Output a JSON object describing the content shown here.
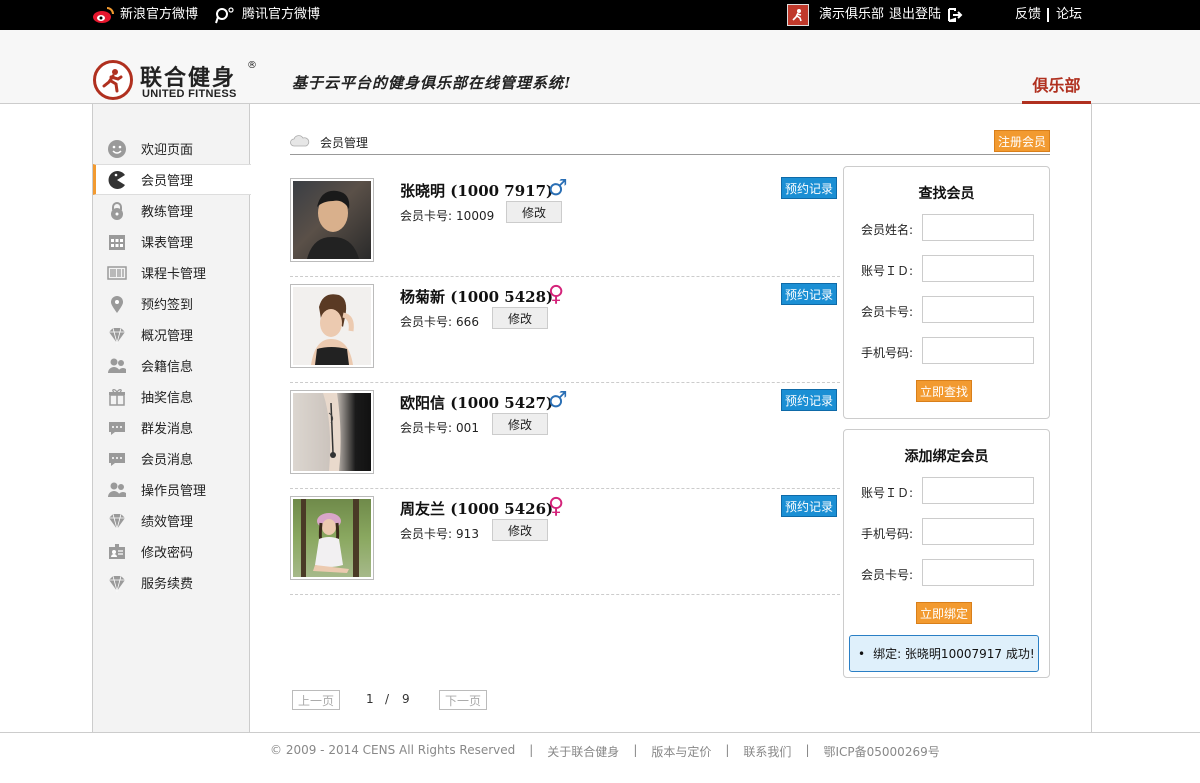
{
  "topbar": {
    "sina_weibo": "新浪官方微博",
    "tencent_weibo": "腾讯官方微博",
    "club_name": "演示俱乐部",
    "logout": "退出登陆",
    "feedback": "反馈",
    "forum": "论坛"
  },
  "header": {
    "logo_cn": "联合健身",
    "logo_reg": "®",
    "logo_en": "UNITED FITNESS",
    "slogan": "基于云平台的健身俱乐部在线管理系统!",
    "active_tab": "俱乐部",
    "brand_color": "#b0301f"
  },
  "sidebar": {
    "items": [
      {
        "label": "欢迎页面",
        "icon": "smiley-icon"
      },
      {
        "label": "会员管理",
        "icon": "pacman-icon"
      },
      {
        "label": "教练管理",
        "icon": "lock-icon"
      },
      {
        "label": "课表管理",
        "icon": "calendar-icon"
      },
      {
        "label": "课程卡管理",
        "icon": "barcode-icon"
      },
      {
        "label": "预约签到",
        "icon": "location-pin-icon"
      },
      {
        "label": "概况管理",
        "icon": "diamond-icon"
      },
      {
        "label": "会籍信息",
        "icon": "users-icon"
      },
      {
        "label": "抽奖信息",
        "icon": "gift-icon"
      },
      {
        "label": "群发消息",
        "icon": "chat-bubble-icon"
      },
      {
        "label": "会员消息",
        "icon": "chat-bubble-icon"
      },
      {
        "label": "操作员管理",
        "icon": "users-icon"
      },
      {
        "label": "绩效管理",
        "icon": "diamond-icon"
      },
      {
        "label": "修改密码",
        "icon": "id-card-icon"
      },
      {
        "label": "服务续费",
        "icon": "diamond-icon"
      }
    ],
    "active_index": 1,
    "active_color": "#f29a30"
  },
  "main": {
    "breadcrumb": "会员管理",
    "register_button": "注册会员",
    "card_label": "会员卡号:",
    "edit_button": "修改",
    "booking_button": "预约记录",
    "members": [
      {
        "name": "张晓明 (1000 7917)",
        "gender": "male",
        "gender_symbol": "♂",
        "card": "10009"
      },
      {
        "name": "杨菊新 (1000 5428)",
        "gender": "female",
        "gender_symbol": "♀",
        "card": "666"
      },
      {
        "name": "欧阳信 (1000 5427)",
        "gender": "male",
        "gender_symbol": "♂",
        "card": "001"
      },
      {
        "name": "周友兰 (1000 5426)",
        "gender": "female",
        "gender_symbol": "♀",
        "card": "913"
      }
    ],
    "pager": {
      "prev": "上一页",
      "current": "1",
      "slash": "/",
      "total": "9",
      "next": "下一页"
    }
  },
  "search_panel": {
    "title": "查找会员",
    "fields": [
      "会员姓名:",
      "账号ＩＤ:",
      "会员卡号:",
      "手机号码:"
    ],
    "button": "立即查找"
  },
  "bind_panel": {
    "title": "添加绑定会员",
    "fields": [
      "账号ＩＤ:",
      "手机号码:",
      "会员卡号:"
    ],
    "button": "立即绑定",
    "message": "绑定: 张晓明10007917 成功!"
  },
  "footer": {
    "copyright": "© 2009 - 2014 CENS All Rights Reserved",
    "about": "关于联合健身",
    "pricing": "版本与定价",
    "contact": "联系我们",
    "icp": "鄂ICP备05000269号",
    "separator": "|"
  }
}
